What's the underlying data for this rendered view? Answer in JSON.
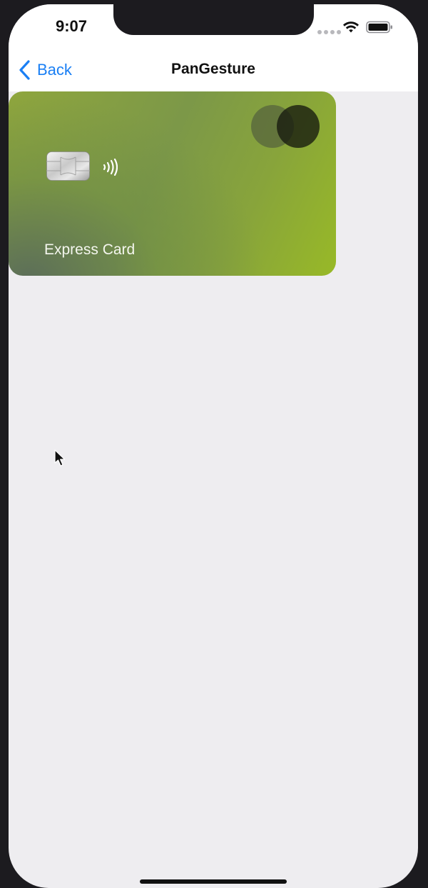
{
  "status_bar": {
    "time": "9:07",
    "icons": [
      "signal-dots-icon",
      "wifi-icon",
      "battery-icon"
    ]
  },
  "nav": {
    "back_label": "Back",
    "title": "PanGesture"
  },
  "card": {
    "label": "Express Card",
    "icons": [
      "card-chip-icon",
      "contactless-icon",
      "card-brand-circles-icon"
    ]
  },
  "colors": {
    "accent": "#1a7ff4",
    "background": "#eeedf0",
    "card_green": "#8fa63d"
  }
}
